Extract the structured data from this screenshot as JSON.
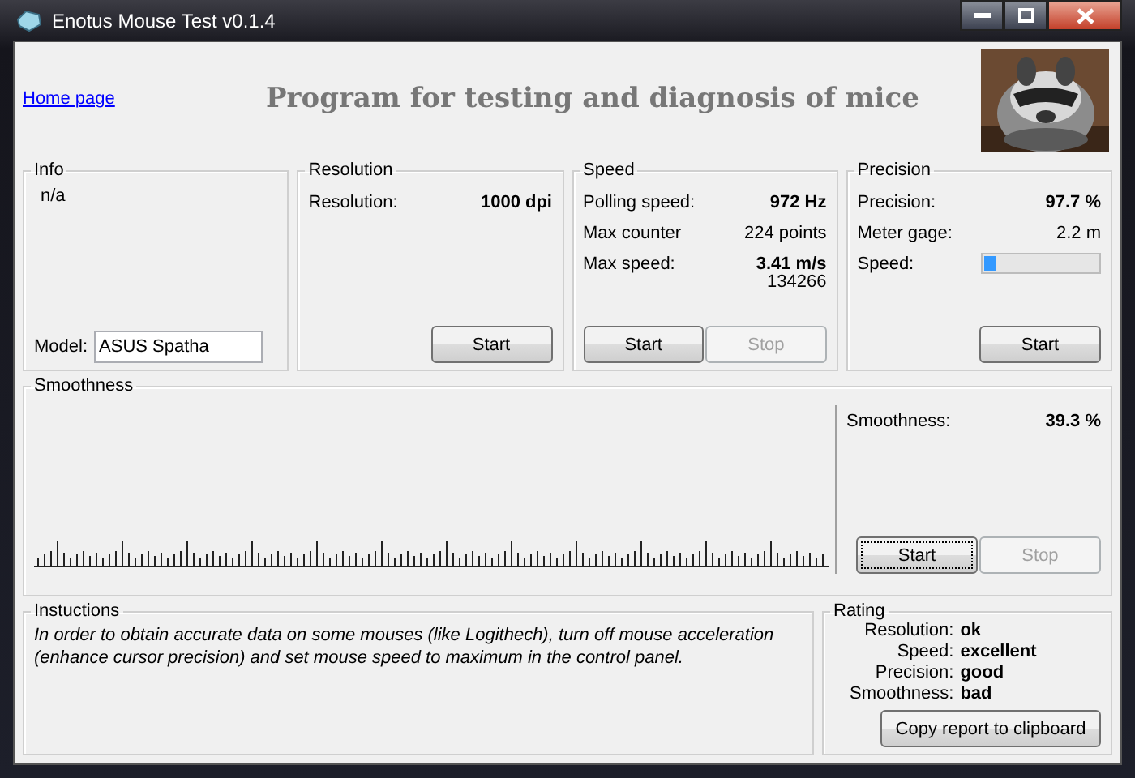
{
  "window": {
    "title": "Enotus Mouse Test v0.1.4"
  },
  "header": {
    "link": "Home page",
    "heading": "Program for testing and diagnosis of mice"
  },
  "info": {
    "title": "Info",
    "text": "n/a",
    "model_label": "Model:",
    "model_value": "ASUS Spatha"
  },
  "resolution": {
    "title": "Resolution",
    "rows": [
      {
        "label": "Resolution:",
        "value": "1000 dpi",
        "bold": true
      }
    ],
    "buttons": [
      {
        "label": "Start",
        "disabled": false,
        "focused": false
      }
    ]
  },
  "speed": {
    "title": "Speed",
    "rows": [
      {
        "label": "Polling speed:",
        "value": "972 Hz",
        "bold": true
      },
      {
        "label": "Max counter",
        "value": "224 points",
        "bold": false
      },
      {
        "label": "Max  speed:",
        "value": "3.41 m/s",
        "bold": true
      }
    ],
    "note": "134266",
    "buttons": [
      {
        "label": "Start",
        "disabled": false,
        "focused": false
      },
      {
        "label": "Stop",
        "disabled": true,
        "focused": false
      }
    ]
  },
  "precision": {
    "title": "Precision",
    "rows": [
      {
        "label": "Precision:",
        "value": "97.7 %",
        "bold": true
      },
      {
        "label": "Meter gage:",
        "value": "2.2 m",
        "bold": false
      }
    ],
    "meter": {
      "label": "Speed:",
      "level": 0.1
    },
    "buttons": [
      {
        "label": "Start",
        "disabled": false,
        "focused": false
      }
    ]
  },
  "smoothness": {
    "title": "Smoothness",
    "label": "Smoothness:",
    "value": "39.3 %",
    "buttons": [
      {
        "label": "Start",
        "disabled": false,
        "focused": true
      },
      {
        "label": "Stop",
        "disabled": true,
        "focused": false
      }
    ]
  },
  "instructions": {
    "title": "Instuctions",
    "text": "In order to obtain accurate data on some mouses (like Logithech), turn off mouse acceleration (enhance cursor precision) and set mouse speed to maximum in the control panel."
  },
  "rating": {
    "title": "Rating",
    "rows": [
      {
        "label": "Resolution:",
        "value": "ok"
      },
      {
        "label": "Speed:",
        "value": "excellent"
      },
      {
        "label": "Precision:",
        "value": "good"
      },
      {
        "label": "Smoothness:",
        "value": "bad"
      }
    ],
    "button": "Copy report to clipboard"
  }
}
